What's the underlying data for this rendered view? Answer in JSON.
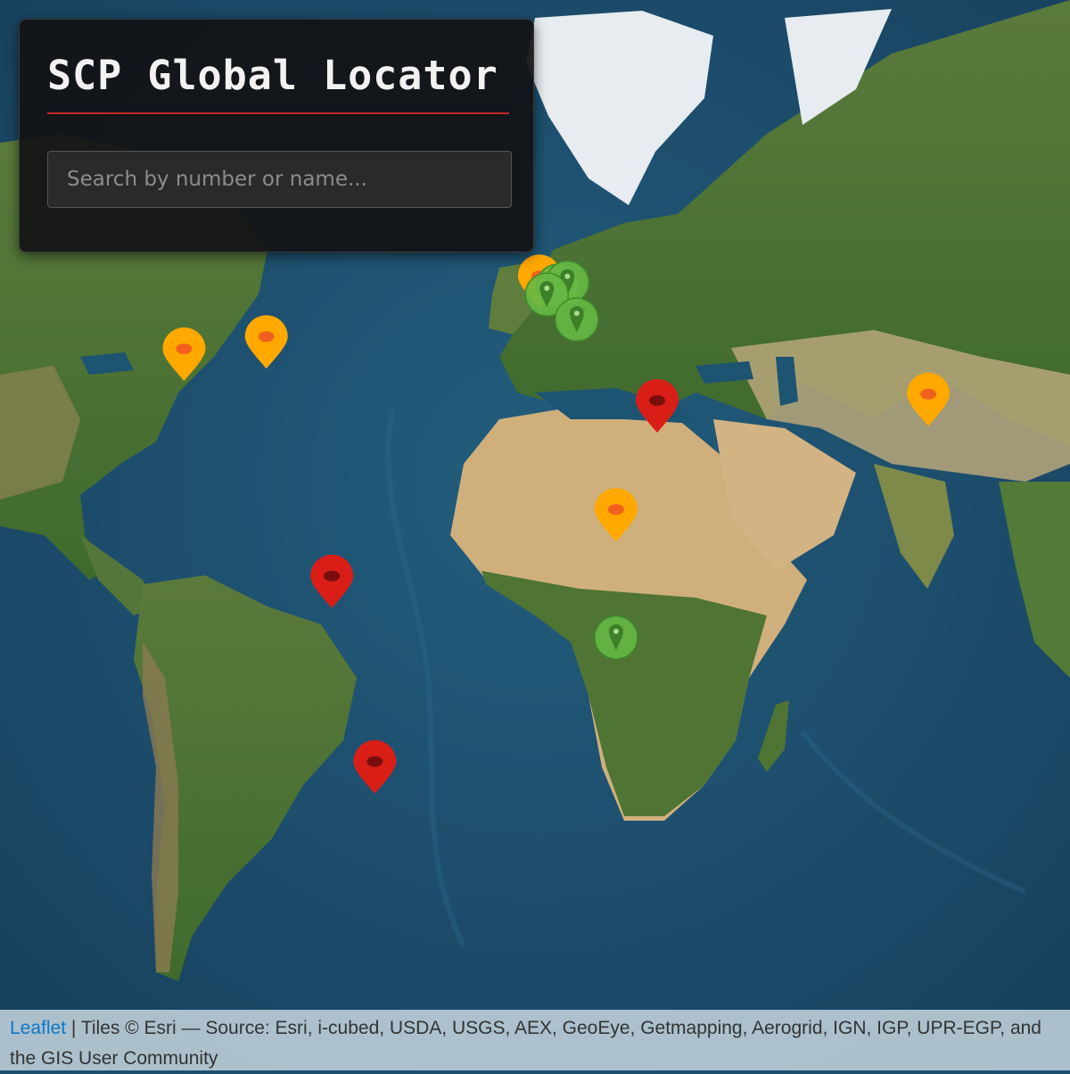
{
  "panel": {
    "title": "SCP Global Locator",
    "search_placeholder": "Search by number or name..."
  },
  "attribution": {
    "link_label": "Leaflet",
    "separator": " | ",
    "text": "Tiles © Esri — Source: Esri, i-cubed, USDA, USGS, AEX, GeoEye, Getmapping, Aerogrid, IGN, IGP, UPR-EGP, and the GIS User Community"
  },
  "colors": {
    "ocean": "#1d5472",
    "ocean_deep": "#173f5c",
    "land_green": "#4d7236",
    "desert": "#cfb07c",
    "ice": "#e9eef0",
    "marker_red": "#d91e18",
    "marker_orange": "#ffa800",
    "marker_green": "#66b845"
  },
  "markers": [
    {
      "type": "orange",
      "lat": 39.0,
      "lng": -95.5
    },
    {
      "type": "orange",
      "lat": 41.5,
      "lng": -73.5
    },
    {
      "type": "orange",
      "lat": 52.5,
      "lng": -0.5
    },
    {
      "type": "green",
      "lat": 51.5,
      "lng": 4.5
    },
    {
      "type": "green",
      "lat": 52.0,
      "lng": 7.0
    },
    {
      "type": "green",
      "lat": 50.0,
      "lng": 1.5
    },
    {
      "type": "green",
      "lat": 45.5,
      "lng": 9.5
    },
    {
      "type": "orange",
      "lat": 29.0,
      "lng": 103.5
    },
    {
      "type": "red",
      "lat": 27.5,
      "lng": 31.0
    },
    {
      "type": "orange",
      "lat": -0.5,
      "lng": 20.0
    },
    {
      "type": "red",
      "lat": -18.0,
      "lng": -56.0
    },
    {
      "type": "green",
      "lat": -32.0,
      "lng": 20.0
    },
    {
      "type": "red",
      "lat": -56.0,
      "lng": -44.5
    }
  ]
}
